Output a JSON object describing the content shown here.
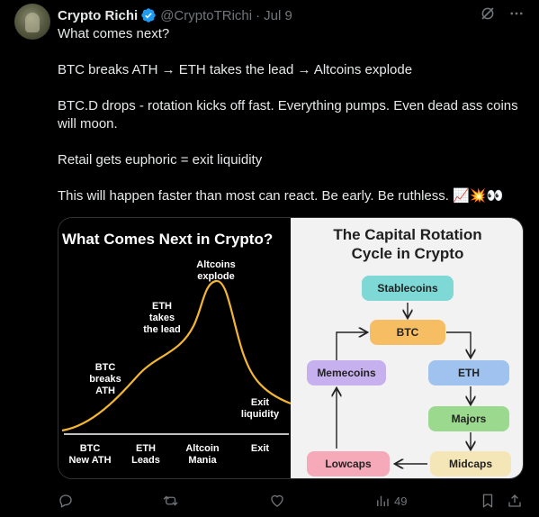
{
  "tweet": {
    "name": "Crypto Richi",
    "handle": "@CryptoTRichi",
    "separator": "·",
    "date": "Jul 9",
    "lines": [
      "What comes next?",
      "BTC breaks ATH → ETH takes the lead → Altcoins explode",
      "BTC.D drops - rotation kicks off fast. Everything pumps. Even dead ass coins will moon.",
      "Retail gets euphoric = exit liquidity",
      "This will happen faster than most can react. Be early. Be ruthless."
    ],
    "emojis": "📈💥👀"
  },
  "left_chart": {
    "title": "What Comes Next in Crypto?",
    "annotations": [
      {
        "l1": "BTC",
        "l2": "breaks",
        "l3": "ATH"
      },
      {
        "l1": "ETH",
        "l2": "takes",
        "l3": "the lead"
      },
      {
        "l1": "Altcoins",
        "l2": "explode"
      },
      {
        "l1": "Exit",
        "l2": "liquidity"
      }
    ],
    "x_labels": [
      {
        "l1": "BTC",
        "l2": "New ATH"
      },
      {
        "l1": "ETH",
        "l2": "Leads"
      },
      {
        "l1": "Altcoin",
        "l2": "Mania"
      },
      {
        "l1": "Exit",
        "l2": ""
      }
    ],
    "curve_color": "#f2b632"
  },
  "right_diagram": {
    "title_l1": "The Capital Rotation",
    "title_l2": "Cycle in Crypto",
    "nodes": {
      "stablecoins": "Stablecoins",
      "btc": "BTC",
      "eth": "ETH",
      "majors": "Majors",
      "midcaps": "Midcaps",
      "lowcaps": "Lowcaps",
      "memecoins": "Memecoins"
    },
    "colors": {
      "stablecoins": "#7ed8d6",
      "btc": "#f6bd63",
      "eth": "#9fc3ee",
      "majors": "#9bd98f",
      "midcaps": "#f4e6b7",
      "lowcaps": "#f6a9b8",
      "memecoins": "#c6b0ee"
    }
  },
  "footer": {
    "views": "49"
  },
  "colors": {
    "background": "#000000",
    "text": "#e7e9ea",
    "muted": "#71767b",
    "verified": "#1d9bf0"
  }
}
